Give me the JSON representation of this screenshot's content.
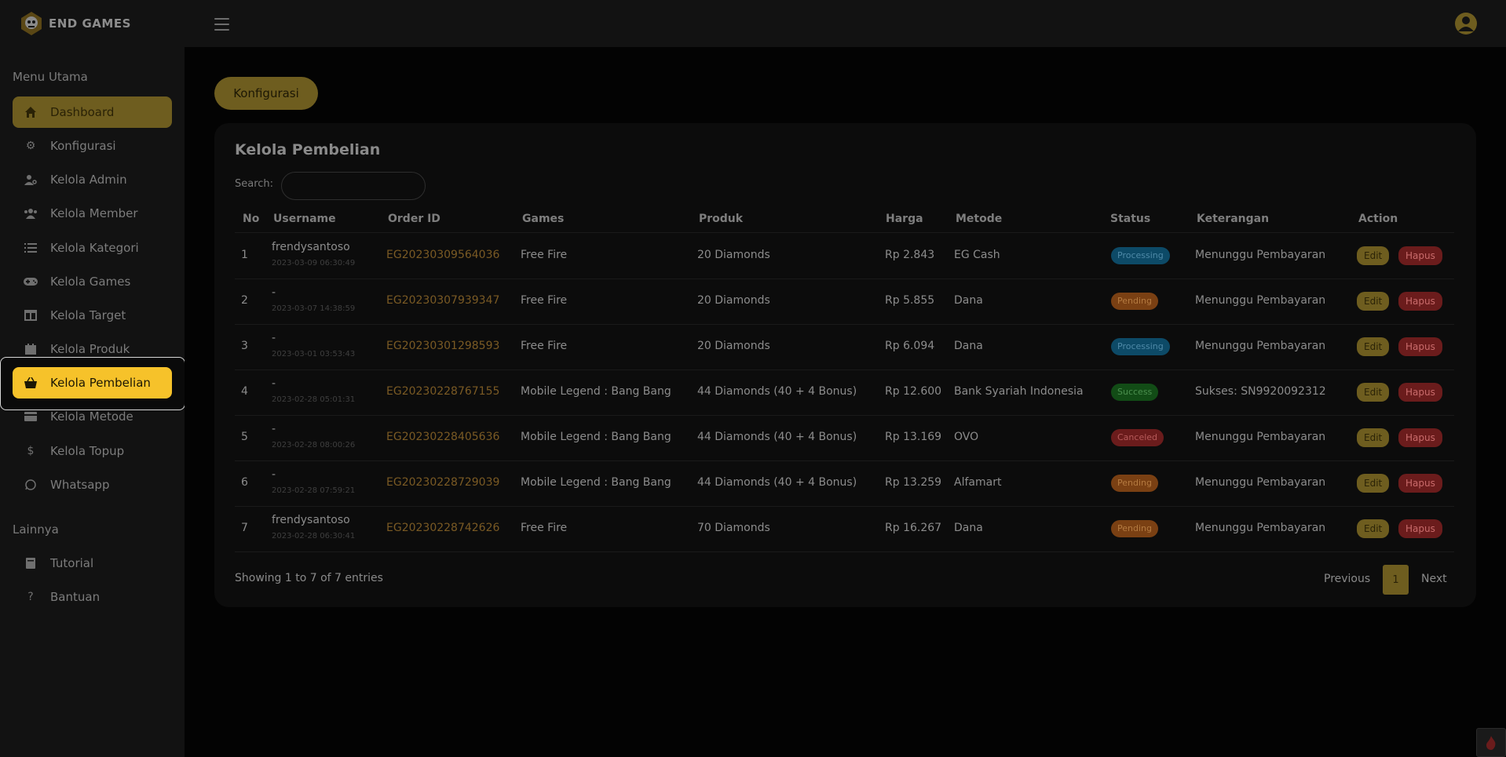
{
  "brand": {
    "name": "END GAMES"
  },
  "sidebar": {
    "section_main": "Menu Utama",
    "section_other": "Lainnya",
    "items": [
      {
        "label": "Dashboard",
        "icon": "home-icon"
      },
      {
        "label": "Konfigurasi",
        "icon": "gear-icon"
      },
      {
        "label": "Kelola Admin",
        "icon": "user-cog-icon"
      },
      {
        "label": "Kelola Member",
        "icon": "users-icon"
      },
      {
        "label": "Kelola Kategori",
        "icon": "list-icon"
      },
      {
        "label": "Kelola Games",
        "icon": "gamepad-icon"
      },
      {
        "label": "Kelola Target",
        "icon": "columns-icon"
      },
      {
        "label": "Kelola Produk",
        "icon": "calendar-icon"
      },
      {
        "label": "Kelola Pembelian",
        "icon": "basket-icon"
      },
      {
        "label": "Kelola Metode",
        "icon": "card-icon"
      },
      {
        "label": "Kelola Topup",
        "icon": "dollar-icon"
      },
      {
        "label": "Whatsapp",
        "icon": "whatsapp-icon"
      }
    ],
    "other_items": [
      {
        "label": "Tutorial",
        "icon": "book-icon"
      },
      {
        "label": "Bantuan",
        "icon": "question-icon"
      }
    ],
    "active_item": "Kelola Pembelian"
  },
  "main": {
    "config_button": "Konfigurasi",
    "card_title": "Kelola Pembelian",
    "search_label": "Search:",
    "search_value": "",
    "columns": [
      "No",
      "Username",
      "Order ID",
      "Games",
      "Produk",
      "Harga",
      "Metode",
      "Status",
      "Keterangan",
      "Action"
    ],
    "rows": [
      {
        "no": "1",
        "username": "frendysantoso",
        "date": "2023-03-09 06:30:49",
        "order_id": "EG20230309564036",
        "game": "Free Fire",
        "produk": "20 Diamonds",
        "harga": "Rp 2.843",
        "metode": "EG Cash",
        "status": "Processing",
        "status_type": "processing",
        "keterangan": "Menunggu Pembayaran"
      },
      {
        "no": "2",
        "username": "-",
        "date": "2023-03-07 14:38:59",
        "order_id": "EG20230307939347",
        "game": "Free Fire",
        "produk": "20 Diamonds",
        "harga": "Rp 5.855",
        "metode": "Dana",
        "status": "Pending",
        "status_type": "pending",
        "keterangan": "Menunggu Pembayaran"
      },
      {
        "no": "3",
        "username": "-",
        "date": "2023-03-01 03:53:43",
        "order_id": "EG20230301298593",
        "game": "Free Fire",
        "produk": "20 Diamonds",
        "harga": "Rp 6.094",
        "metode": "Dana",
        "status": "Processing",
        "status_type": "processing",
        "keterangan": "Menunggu Pembayaran"
      },
      {
        "no": "4",
        "username": "-",
        "date": "2023-02-28 05:01:31",
        "order_id": "EG20230228767155",
        "game": "Mobile Legend : Bang Bang",
        "produk": "44 Diamonds (40 + 4 Bonus)",
        "harga": "Rp 12.600",
        "metode": "Bank Syariah Indonesia",
        "status": "Success",
        "status_type": "success",
        "keterangan": "Sukses: SN9920092312"
      },
      {
        "no": "5",
        "username": "-",
        "date": "2023-02-28 08:00:26",
        "order_id": "EG20230228405636",
        "game": "Mobile Legend : Bang Bang",
        "produk": "44 Diamonds (40 + 4 Bonus)",
        "harga": "Rp 13.169",
        "metode": "OVO",
        "status": "Canceled",
        "status_type": "canceled",
        "keterangan": "Menunggu Pembayaran"
      },
      {
        "no": "6",
        "username": "-",
        "date": "2023-02-28 07:59:21",
        "order_id": "EG20230228729039",
        "game": "Mobile Legend : Bang Bang",
        "produk": "44 Diamonds (40 + 4 Bonus)",
        "harga": "Rp 13.259",
        "metode": "Alfamart",
        "status": "Pending",
        "status_type": "pending",
        "keterangan": "Menunggu Pembayaran"
      },
      {
        "no": "7",
        "username": "frendysantoso",
        "date": "2023-02-28 06:30:41",
        "order_id": "EG20230228742626",
        "game": "Free Fire",
        "produk": "70 Diamonds",
        "harga": "Rp 16.267",
        "metode": "Dana",
        "status": "Pending",
        "status_type": "pending",
        "keterangan": "Menunggu Pembayaran"
      }
    ],
    "edit_label": "Edit",
    "delete_label": "Hapus",
    "showing": "Showing 1 to 7 of 7 entries",
    "pagination": {
      "prev": "Previous",
      "page": "1",
      "next": "Next"
    }
  },
  "colors": {
    "accent": "#f6c22a",
    "accent_dim": "#6e5d1f",
    "background": "#050505",
    "panel": "#121212"
  }
}
